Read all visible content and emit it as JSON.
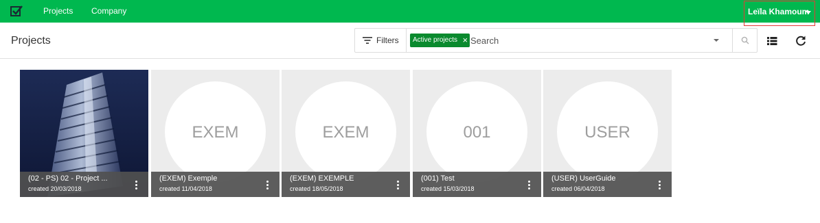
{
  "nav": {
    "logo": "check-box-icon",
    "links": [
      "Projects",
      "Company"
    ],
    "user_name": "Leïla Khamoum",
    "brand_color": "#00b84f"
  },
  "header": {
    "title": "Projects",
    "filters_label": "Filters",
    "active_filter_chip": "Active projects",
    "search_placeholder": "Search"
  },
  "projects": [
    {
      "code": "",
      "name": "(02 - PS) 02 - Project ...",
      "created": "created 20/03/2018",
      "has_photo": true
    },
    {
      "code": "EXEM",
      "name": "(EXEM) Exemple",
      "created": "created 11/04/2018",
      "has_photo": false
    },
    {
      "code": "EXEM",
      "name": "(EXEM) EXEMPLE",
      "created": "created 18/05/2018",
      "has_photo": false
    },
    {
      "code": "001",
      "name": "(001) Test",
      "created": "created 15/03/2018",
      "has_photo": false
    },
    {
      "code": "USER",
      "name": "(USER) UserGuide",
      "created": "created 06/04/2018",
      "has_photo": false
    }
  ]
}
